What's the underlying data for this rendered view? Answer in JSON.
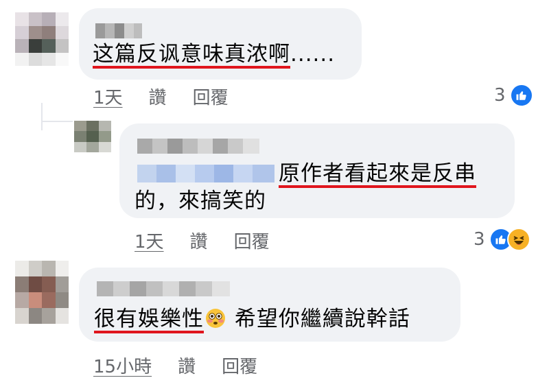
{
  "comments": [
    {
      "text_underlined": "这篇反讽意味真浓啊",
      "text_rest": "......",
      "time": "1天",
      "like": "讚",
      "reply": "回覆",
      "reaction_count": "3",
      "reactions": [
        "like-icon"
      ]
    },
    {
      "text_line1_underlined": "原作者看起來是反串",
      "text_line2": "的，來搞笑的",
      "time": "1天",
      "like": "讚",
      "reply": "回覆",
      "reaction_count": "3",
      "reactions": [
        "like-icon",
        "haha-icon"
      ]
    },
    {
      "text_underlined": "很有娛樂性",
      "emoji": "flushed-face-icon",
      "text_rest": " 希望你繼續說幹話",
      "time": "15小時",
      "like": "讚",
      "reply": "回覆"
    }
  ],
  "colors": {
    "bubble": "#f0f2f5",
    "underline": "#e0151d",
    "meta_text": "#65676b",
    "like_blue": "#1877f2",
    "haha_yellow": "#f7b125"
  }
}
